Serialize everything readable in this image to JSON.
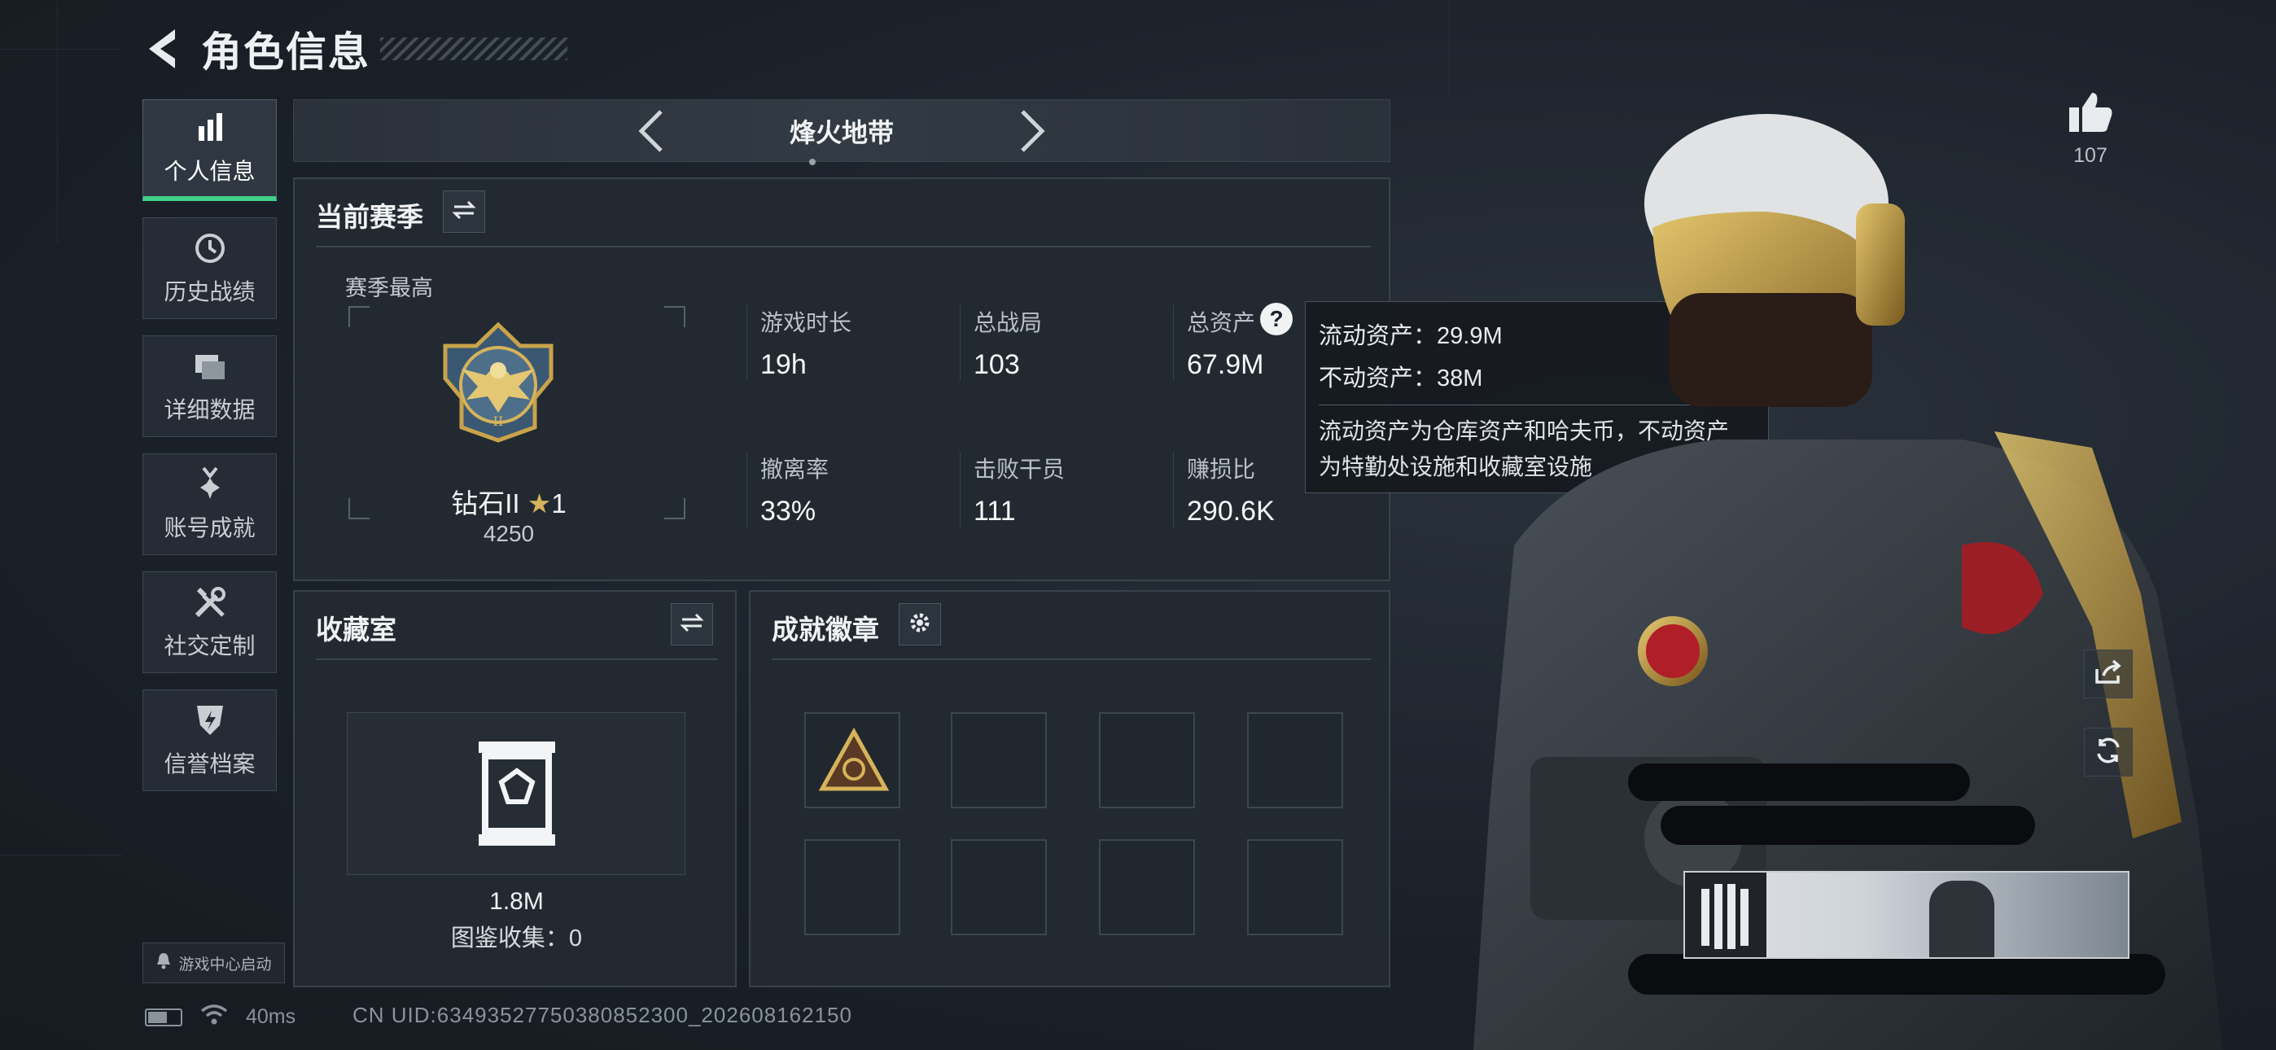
{
  "header": {
    "title": "角色信息"
  },
  "sidebar": {
    "items": [
      {
        "label": "个人信息",
        "icon": "bar-chart-icon",
        "active": true
      },
      {
        "label": "历史战绩",
        "icon": "clock-history-icon",
        "active": false
      },
      {
        "label": "详细数据",
        "icon": "folders-icon",
        "active": false
      },
      {
        "label": "账号成就",
        "icon": "medal-icon",
        "active": false
      },
      {
        "label": "社交定制",
        "icon": "wrench-tools-icon",
        "active": false
      },
      {
        "label": "信誉档案",
        "icon": "shield-lightning-icon",
        "active": false
      }
    ],
    "launch_label": "游戏中心启动"
  },
  "mode": {
    "label": "烽火地带"
  },
  "season": {
    "title": "当前赛季",
    "best_label": "赛季最高",
    "rank_name": "钻石II",
    "rank_stars": "1",
    "rank_score": "4250",
    "stats": [
      {
        "label": "游戏时长",
        "value": "19h"
      },
      {
        "label": "总战局",
        "value": "103"
      },
      {
        "label": "总资产",
        "value": "67.9M"
      },
      {
        "label": "撤离率",
        "value": "33%"
      },
      {
        "label": "击败干员",
        "value": "111"
      },
      {
        "label": "赚损比",
        "value": "290.6K"
      }
    ]
  },
  "tooltip": {
    "liquid": "流动资产：29.9M",
    "fixed": "不动资产：38M",
    "desc_line1": "流动资产为仓库资产和哈夫币，不动资产",
    "desc_line2": "为特勤处设施和收藏室设施"
  },
  "collection": {
    "title": "收藏室",
    "value": "1.8M",
    "codex": "图鉴收集：0"
  },
  "badges": {
    "title": "成就徽章"
  },
  "like": {
    "count": "107"
  },
  "status": {
    "ping": "40ms",
    "uid": "CN UID:6349352775038085230​0_202608162150"
  },
  "colors": {
    "accent": "#3fd08a",
    "panel": "#222930",
    "gold": "#c9a34a"
  }
}
